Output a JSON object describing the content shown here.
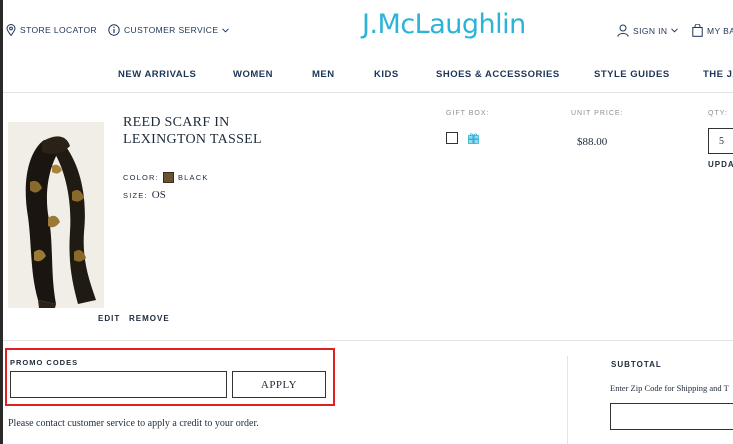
{
  "header": {
    "store_locator": "STORE LOCATOR",
    "customer_service": "CUSTOMER SERVICE",
    "logo": "J.McLaughlin",
    "sign_in": "SIGN IN",
    "my_bag": "MY BA"
  },
  "nav": {
    "items": [
      "NEW ARRIVALS",
      "WOMEN",
      "MEN",
      "KIDS",
      "SHOES & ACCESSORIES",
      "STYLE GUIDES",
      "THE JA"
    ]
  },
  "cart": {
    "columns": {
      "gift_box": "GIFT BOX:",
      "unit_price": "UNIT PRICE:",
      "qty": "QTY:"
    },
    "item": {
      "name": "REED SCARF IN LEXINGTON TASSEL",
      "color_label": "COLOR:",
      "color_value": "BLACK",
      "size_label": "SIZE:",
      "size_value": "OS",
      "price": "$88.00",
      "qty": "5",
      "update": "UPDA",
      "edit": "EDIT",
      "remove": "REMOVE"
    }
  },
  "promo": {
    "label": "PROMO CODES",
    "input_value": "",
    "apply": "APPLY",
    "note": "Please contact customer service to apply a credit to your order."
  },
  "summary": {
    "subtotal": "SUBTOTAL",
    "zip_note": "Enter Zip Code for Shipping and T",
    "zip_value": ""
  },
  "colors": {
    "brand": "#2bb3d9",
    "navy": "#1d3557",
    "highlight": "#e02020"
  }
}
